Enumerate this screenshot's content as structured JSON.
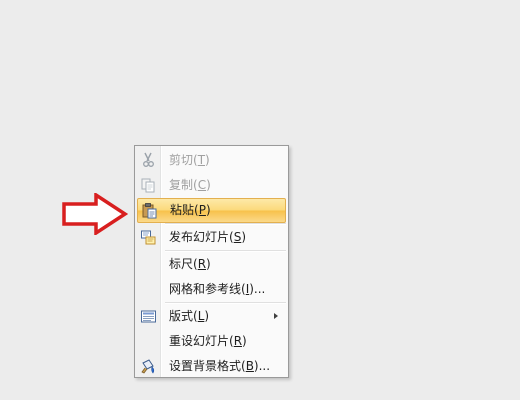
{
  "menu": {
    "items": [
      {
        "label": "剪切(T)",
        "icon": "scissors-icon",
        "disabled": true
      },
      {
        "label": "复制(C)",
        "icon": "copy-icon",
        "disabled": true
      },
      {
        "label": "粘贴(P)",
        "icon": "paste-icon",
        "disabled": false,
        "highlighted": true
      },
      {
        "label": "发布幻灯片(S)",
        "icon": "publish-slides-icon",
        "disabled": false
      },
      {
        "label": "标尺(R)",
        "icon": "",
        "disabled": false
      },
      {
        "label": "网格和参考线(I)...",
        "icon": "",
        "disabled": false
      },
      {
        "label": "版式(L)",
        "icon": "layout-icon",
        "disabled": false,
        "submenu": true
      },
      {
        "label": "重设幻灯片(R)",
        "icon": "",
        "disabled": false
      },
      {
        "label": "设置背景格式(B)...",
        "icon": "format-background-icon",
        "disabled": false
      }
    ]
  },
  "colors": {
    "highlight": "#fbd97a",
    "arrow": "#d81f1f",
    "disabled_text": "#a0a0a0"
  }
}
